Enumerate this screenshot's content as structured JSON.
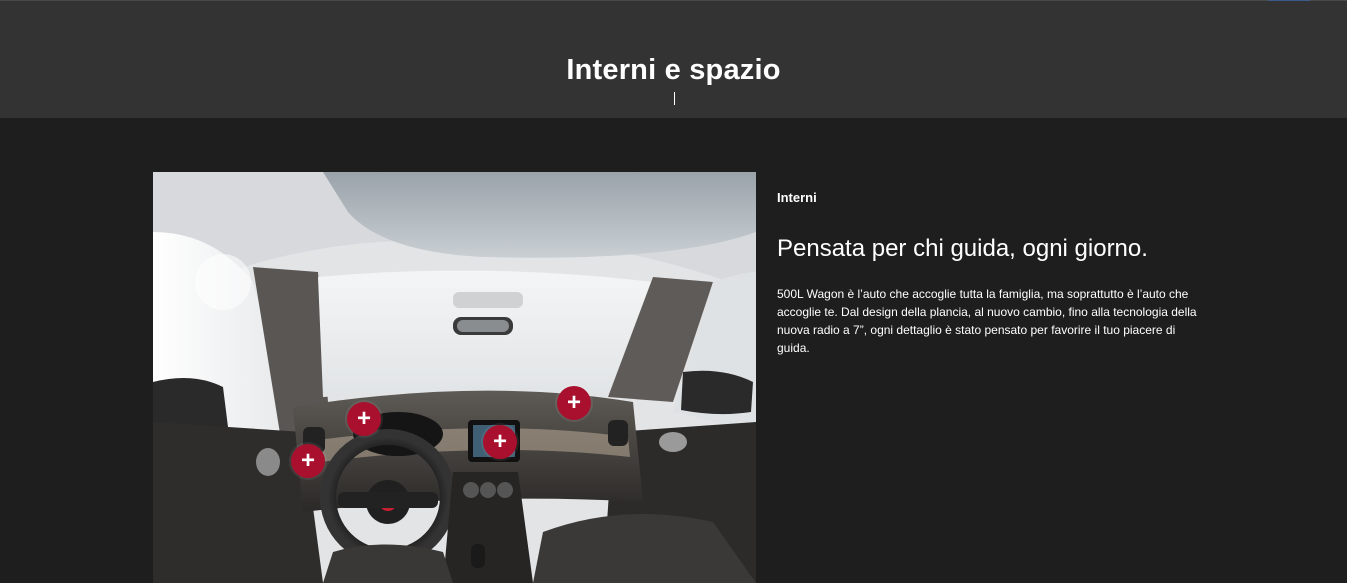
{
  "section": {
    "title": "Interni e spazio"
  },
  "feature": {
    "eyebrow": "Interni",
    "headline": "Pensata per chi guida, ogni giorno.",
    "body": "500L Wagon è l’auto che accoglie tutta la famiglia, ma soprattutto è l’auto che accoglie te. Dal design della plancia, al nuovo cambio, fino alla tecnologia della nuova radio a 7”, ogni dettaglio è stato pensato per favorire il tuo piacere di guida."
  },
  "hotspots": [
    {
      "label": "+"
    },
    {
      "label": "+"
    },
    {
      "label": "+"
    },
    {
      "label": "+"
    }
  ],
  "colors": {
    "page_bg": "#1e1e1e",
    "header_bg": "#333333",
    "hotspot": "#a8102e",
    "text": "#ffffff"
  },
  "icons": {
    "hotspot": "plus-icon"
  }
}
